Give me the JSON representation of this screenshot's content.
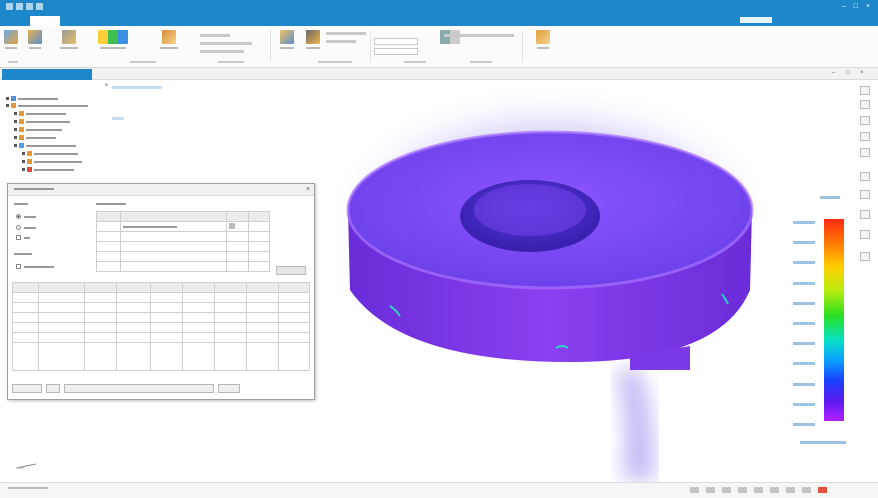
{
  "window": {
    "title": "",
    "account": "",
    "min_icon": "minimize-icon",
    "max_icon": "maximize-icon",
    "close_icon": "close-icon"
  },
  "menu_tabs": [],
  "ribbon": {
    "buttons": [],
    "group_labels": []
  },
  "document_tab": {
    "label": ""
  },
  "model_tree": {
    "header": "",
    "nodes": []
  },
  "viewport": {
    "text_lines": [],
    "colors": {
      "part_body": "#7a3cf0",
      "part_rim": "#a060ff",
      "hole_inner": "#3a1fc0",
      "fog": "#6a5ae8",
      "edge_hint": "#30d0c8"
    }
  },
  "legend": {
    "title": "",
    "labels": [],
    "footer": "",
    "colors": [
      "#ff2a10",
      "#ff7a00",
      "#ffd000",
      "#b4ec10",
      "#28e022",
      "#08e0c8",
      "#0aa0ff",
      "#1a40ff",
      "#5a1cf0",
      "#b020ff"
    ]
  },
  "dialog": {
    "title": "",
    "section_labels": [],
    "radios": [],
    "checkbox": "",
    "apply_button": "",
    "top_table": {
      "columns": [],
      "rows": []
    },
    "main_table": {
      "columns": [],
      "rows": []
    },
    "footer_buttons": []
  },
  "accent": "#1d87c9"
}
